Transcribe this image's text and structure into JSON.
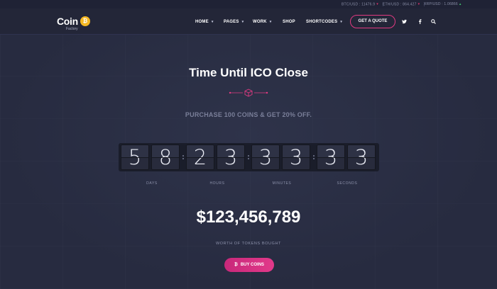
{
  "ticker": [
    {
      "label": "BTC/USD : 11476.9",
      "trend": "down"
    },
    {
      "label": "ETH/USD : 864.427",
      "trend": "down"
    },
    {
      "label": "XRP/USD : 1.06866",
      "trend": "up"
    }
  ],
  "header": {
    "logo_text": "Coin",
    "logo_sub": "Factory",
    "logo_coin_icon": "₿",
    "nav": [
      {
        "label": "HOME",
        "has_caret": true
      },
      {
        "label": "PAGES",
        "has_caret": true
      },
      {
        "label": "WORK",
        "has_caret": true
      },
      {
        "label": "SHOP",
        "has_caret": false
      },
      {
        "label": "SHORTCODES",
        "has_caret": true
      }
    ],
    "quote_button": "GET A QUOTE",
    "social_icons": [
      "twitter-icon",
      "facebook-icon",
      "search-icon"
    ]
  },
  "hero": {
    "title": "Time Until ICO Close",
    "promo": "PURCHASE 100 COINS & GET 20% OFF.",
    "countdown": {
      "days": [
        "5",
        "8"
      ],
      "hours": [
        "2",
        "3"
      ],
      "minutes": [
        "3",
        "3"
      ],
      "seconds": [
        "3",
        "3"
      ]
    },
    "units": {
      "days": "DAYS",
      "hours": "HOURS",
      "minutes": "MINUTES",
      "seconds": "SECONDS"
    },
    "amount": "$123,456,789",
    "amount_label": "WORTH OF TOKENS BOUGHT",
    "buy_button": "BUY COINS",
    "buy_icon": "₿"
  },
  "colors": {
    "accent": "#e23a82",
    "background": "#272b3f",
    "coin": "#f5b824"
  }
}
